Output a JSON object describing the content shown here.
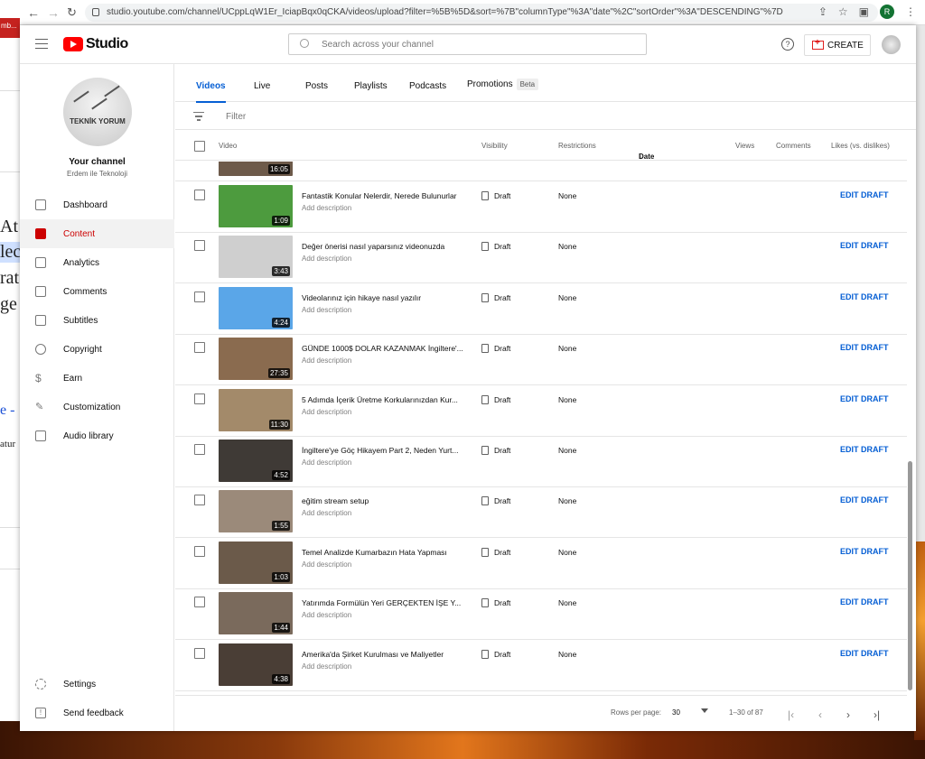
{
  "browser": {
    "url": "studio.youtube.com/channel/UCppLqW1Er_IciapBqx0qCKA/videos/upload?filter=%5B%5D&sort=%7B\"columnType\"%3A\"date\"%2C\"sortOrder\"%3A\"DESCENDING\"%7D",
    "profile_initial": "R"
  },
  "background": {
    "tab_text": "mb...",
    "lines": [
      "At",
      "lec",
      "rat",
      "ge",
      "e -",
      "atur"
    ]
  },
  "header": {
    "logo_text": "Studio",
    "search_placeholder": "Search across your channel",
    "create_label": "CREATE"
  },
  "sidebar": {
    "channel_logo_text": "TEKNİK YORUM",
    "your_channel": "Your channel",
    "channel_name": "Erdem ile Teknoloji",
    "items": [
      {
        "label": "Dashboard",
        "icon": "dashboard-icon"
      },
      {
        "label": "Content",
        "icon": "content-icon",
        "active": true
      },
      {
        "label": "Analytics",
        "icon": "analytics-icon"
      },
      {
        "label": "Comments",
        "icon": "comments-icon"
      },
      {
        "label": "Subtitles",
        "icon": "subtitles-icon"
      },
      {
        "label": "Copyright",
        "icon": "copyright-icon"
      },
      {
        "label": "Earn",
        "icon": "earn-icon"
      },
      {
        "label": "Customization",
        "icon": "customization-icon"
      },
      {
        "label": "Audio library",
        "icon": "audio-library-icon"
      }
    ],
    "bottom_items": [
      {
        "label": "Settings",
        "icon": "gear-icon"
      },
      {
        "label": "Send feedback",
        "icon": "feedback-icon"
      }
    ]
  },
  "tabs": [
    {
      "label": "Videos",
      "active": true
    },
    {
      "label": "Live"
    },
    {
      "label": "Posts"
    },
    {
      "label": "Playlists"
    },
    {
      "label": "Podcasts"
    },
    {
      "label": "Promotions",
      "badge": "Beta"
    }
  ],
  "filter": {
    "placeholder": "Filter"
  },
  "table": {
    "headers": {
      "video": "Video",
      "visibility": "Visibility",
      "restrictions": "Restrictions",
      "date": "Date",
      "views": "Views",
      "comments": "Comments",
      "likes": "Likes (vs. dislikes)"
    },
    "partial_row_duration": "16:05",
    "rows": [
      {
        "title": "Fantastik Konular Nelerdir, Nerede Bulunurlar",
        "description": "Add description",
        "duration": "1:09",
        "visibility": "Draft",
        "restrictions": "None",
        "action": "EDIT DRAFT",
        "thumb_color": "#4d9b3e"
      },
      {
        "title": "Değer önerisi nasıl yaparsınız videonuzda",
        "description": "Add description",
        "duration": "3:43",
        "visibility": "Draft",
        "restrictions": "None",
        "action": "EDIT DRAFT",
        "thumb_color": "#cfcfcf"
      },
      {
        "title": "Videolarınız için hikaye nasıl yazılır",
        "description": "Add description",
        "duration": "4:24",
        "visibility": "Draft",
        "restrictions": "None",
        "action": "EDIT DRAFT",
        "thumb_color": "#5aa6e8"
      },
      {
        "title": "GÜNDE 1000$ DOLAR KAZANMAK İngiltere'...",
        "description": "Add description",
        "duration": "27:35",
        "visibility": "Draft",
        "restrictions": "None",
        "action": "EDIT DRAFT",
        "thumb_color": "#8a6b4f"
      },
      {
        "title": "5 Adımda İçerik Üretme Korkularınızdan Kur...",
        "description": "Add description",
        "duration": "11:30",
        "visibility": "Draft",
        "restrictions": "None",
        "action": "EDIT DRAFT",
        "thumb_color": "#a38a6a"
      },
      {
        "title": "İngiltere'ye Göç Hikayem Part 2, Neden Yurt...",
        "description": "Add description",
        "duration": "4:52",
        "visibility": "Draft",
        "restrictions": "None",
        "action": "EDIT DRAFT",
        "thumb_color": "#3f3a36"
      },
      {
        "title": "eğitim stream setup",
        "description": "Add description",
        "duration": "1:55",
        "visibility": "Draft",
        "restrictions": "None",
        "action": "EDIT DRAFT",
        "thumb_color": "#9b8a7a"
      },
      {
        "title": "Temel Analizde Kumarbazın Hata Yapması",
        "description": "Add description",
        "duration": "1:03",
        "visibility": "Draft",
        "restrictions": "None",
        "action": "EDIT DRAFT",
        "thumb_color": "#6b5a4a"
      },
      {
        "title": "Yatırımda Formülün Yeri GERÇEKTEN İŞE Y...",
        "description": "Add description",
        "duration": "1:44",
        "visibility": "Draft",
        "restrictions": "None",
        "action": "EDIT DRAFT",
        "thumb_color": "#7a6a5c"
      },
      {
        "title": "Amerika'da Şirket Kurulması ve Maliyetler",
        "description": "Add description",
        "duration": "4:38",
        "visibility": "Draft",
        "restrictions": "None",
        "action": "EDIT DRAFT",
        "thumb_color": "#4a3e36"
      }
    ]
  },
  "pagination": {
    "rows_per_page_label": "Rows per page:",
    "rows_per_page": "30",
    "range": "1–30 of 87"
  },
  "colors": {
    "accent": "#065fd4",
    "brand": "#ff0000",
    "active_nav": "#cc0000"
  }
}
